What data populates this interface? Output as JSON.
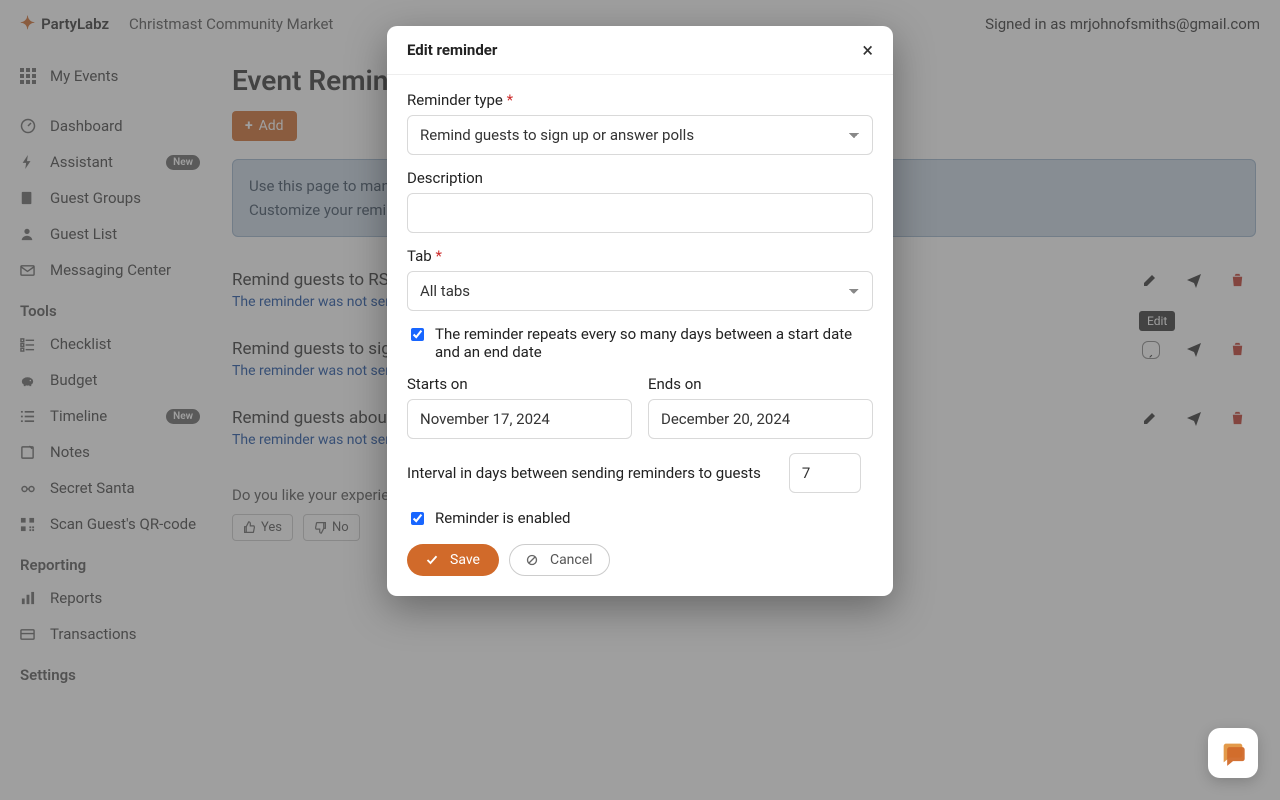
{
  "brand": "PartyLabz",
  "breadcrumb": "Christmast Community Market",
  "signed_in_prefix": "Signed in as ",
  "signed_in_email": "mrjohnofsmiths@gmail.com",
  "sidebar": {
    "my_events": "My Events",
    "items": [
      {
        "icon": "dashboard",
        "label": "Dashboard"
      },
      {
        "icon": "bolt",
        "label": "Assistant",
        "badge": "New"
      },
      {
        "icon": "groups",
        "label": "Guest Groups"
      },
      {
        "icon": "person",
        "label": "Guest List"
      },
      {
        "icon": "mail",
        "label": "Messaging Center"
      }
    ],
    "tools_heading": "Tools",
    "tools": [
      {
        "icon": "check",
        "label": "Checklist"
      },
      {
        "icon": "piggy",
        "label": "Budget"
      },
      {
        "icon": "timeline",
        "label": "Timeline",
        "badge": "New"
      },
      {
        "icon": "note",
        "label": "Notes"
      },
      {
        "icon": "santa",
        "label": "Secret Santa"
      },
      {
        "icon": "qr",
        "label": "Scan Guest's QR-code"
      }
    ],
    "reporting_heading": "Reporting",
    "reporting": [
      {
        "icon": "bar",
        "label": "Reports"
      },
      {
        "icon": "card",
        "label": "Transactions"
      }
    ],
    "settings_heading": "Settings"
  },
  "page_title": "Event Reminders",
  "add_label": "Add",
  "help_line1": "Use this page to manage reminders for your event.",
  "help_line2": "Customize your reminders below or disable them completely.",
  "reminders": [
    {
      "title": "Remind guests to RSVP",
      "sub": "The reminder was not sent yet"
    },
    {
      "title": "Remind guests to sign up or answer polls",
      "sub": "The reminder was not sent yet"
    },
    {
      "title": "Remind guests about the event",
      "sub": "The reminder was not sent yet"
    }
  ],
  "edit_tooltip": "Edit",
  "feedback_q": "Do you like your experience with PartyLabz?",
  "feedback_yes": "Yes",
  "feedback_no": "No",
  "modal": {
    "title": "Edit reminder",
    "type_label": "Reminder type",
    "type_value": "Remind guests to sign up or answer polls",
    "desc_label": "Description",
    "desc_value": "",
    "tab_label": "Tab",
    "tab_value": "All tabs",
    "repeat_label": "The reminder repeats every so many days between a start date and an end date",
    "starts_label": "Starts on",
    "starts_value": "November 17, 2024",
    "ends_label": "Ends on",
    "ends_value": "December 20, 2024",
    "interval_label": "Interval in days between sending reminders to guests",
    "interval_value": "7",
    "enabled_label": "Reminder is enabled",
    "save": "Save",
    "cancel": "Cancel"
  }
}
